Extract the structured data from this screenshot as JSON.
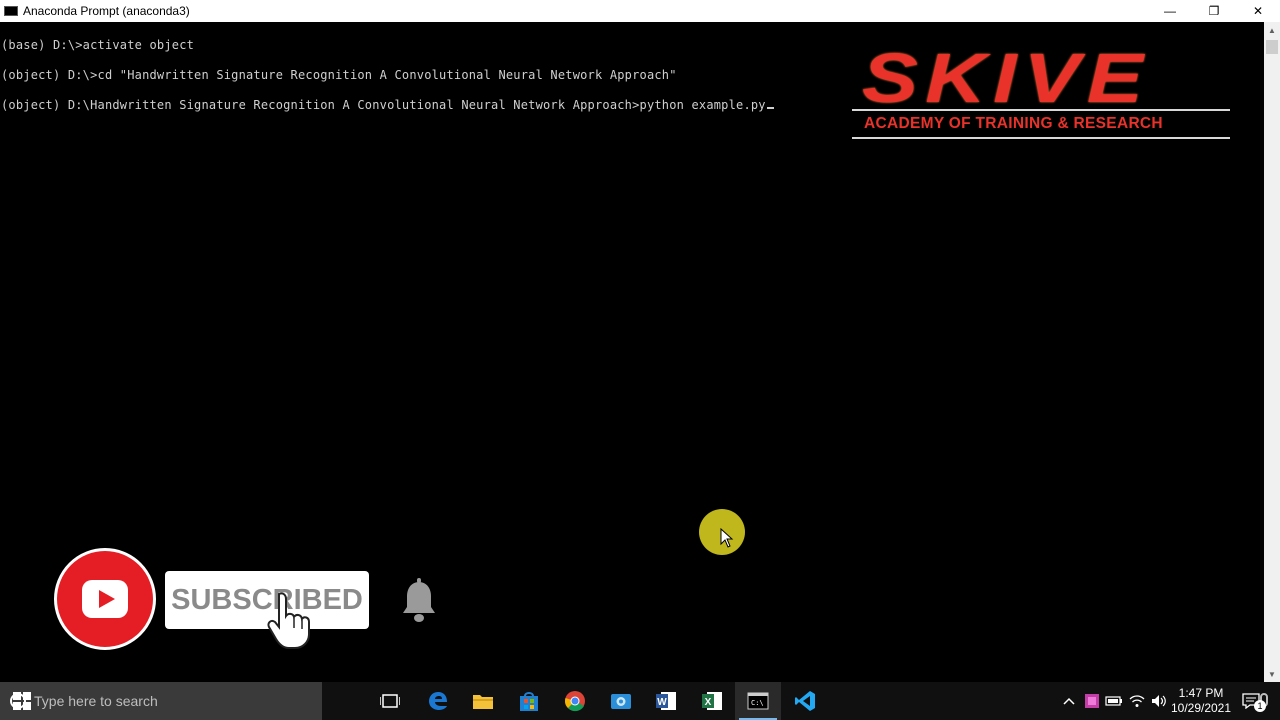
{
  "window": {
    "title": "Anaconda Prompt (anaconda3)",
    "minimize_glyph": "—",
    "maximize_glyph": "❐",
    "close_glyph": "✕"
  },
  "console": {
    "lines": [
      "(base) D:\\>activate object",
      "(object) D:\\>cd \"Handwritten Signature Recognition A Convolutional Neural Network Approach\"",
      "(object) D:\\Handwritten Signature Recognition A Convolutional Neural Network Approach>python example.py"
    ]
  },
  "logo": {
    "name": "SKIVE",
    "tagline": "ACADEMY OF TRAINING & RESEARCH"
  },
  "subscribe": {
    "label": "SUBSCRIBED"
  },
  "taskbar": {
    "search_placeholder": "Type here to search",
    "apps": [
      "task-view-icon",
      "edge-icon",
      "file-explorer-icon",
      "store-icon",
      "chrome-icon",
      "camera-app-icon",
      "word-icon",
      "excel-icon",
      "terminal-icon",
      "vscode-icon"
    ],
    "clock_time": "1:47 PM",
    "clock_date": "10/29/2021",
    "notification_count": "1"
  },
  "colors": {
    "console_bg": "#000000",
    "console_text": "#cfcfcf",
    "logo_red": "#e8322a",
    "youtube_red": "#e51e25",
    "taskbar_bg": "#101010",
    "mouse_highlight": "#c9c11c"
  }
}
